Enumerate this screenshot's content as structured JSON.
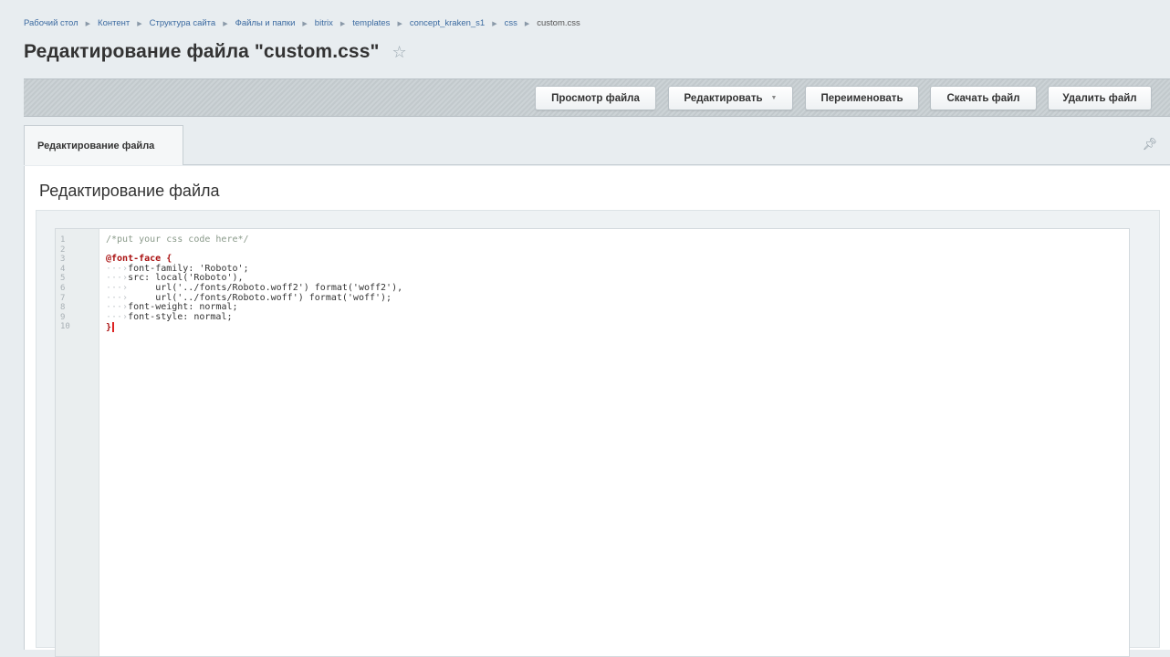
{
  "breadcrumb": [
    "Рабочий стол",
    "Контент",
    "Структура сайта",
    "Файлы и папки",
    "bitrix",
    "templates",
    "concept_kraken_s1",
    "css",
    "custom.css"
  ],
  "page_title": "Редактирование файла \"custom.css\"",
  "toolbar": {
    "view_label": "Просмотр файла",
    "edit_label": "Редактировать",
    "rename_label": "Переименовать",
    "download_label": "Скачать файл",
    "delete_label": "Удалить файл"
  },
  "tabs": [
    {
      "label": "Редактирование файла",
      "active": true
    }
  ],
  "section_title": "Редактирование файла",
  "editor": {
    "line_numbers": [
      "1",
      "2",
      "3",
      "4",
      "5",
      "6",
      "7",
      "8",
      "9",
      "10"
    ],
    "lines": [
      "/*put your css code here*/",
      "",
      "@font-face {",
      "font-family: 'Roboto';",
      "src: local('Roboto'),",
      "url('../fonts/Roboto.woff2') format('woff2'),",
      "url('../fonts/Roboto.woff') format('woff');",
      "font-weight: normal;",
      "font-style: normal;",
      "}"
    ]
  },
  "colors": {
    "background": "#e8edf0",
    "toolbar": "#c8cfd3",
    "link": "#3b6aa0",
    "comment": "#8a9a8a",
    "at_rule": "#aa1111",
    "string": "#a78ac0",
    "keyword_value": "#6a3fa0",
    "cursor": "#dd2222"
  },
  "icons": {
    "favorite": "star-icon",
    "pin": "pin-icon",
    "dropdown": "chevron-down-icon",
    "separator": "chevron-right-icon"
  }
}
